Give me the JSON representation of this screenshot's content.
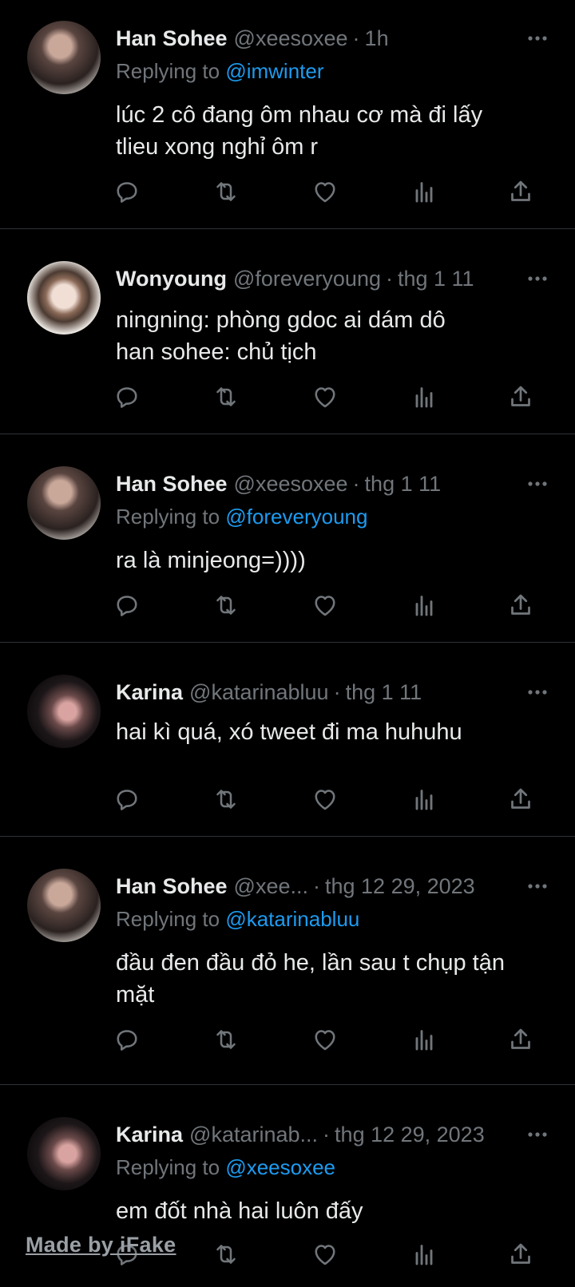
{
  "tweets": [
    {
      "name": "Han Sohee",
      "handle": "@xeesoxee",
      "sep": "·",
      "time": "1h",
      "replying_prefix": "Replying to",
      "replying_to": "@imwinter",
      "lines": [
        "lúc 2 cô đang ôm nhau cơ mà đi lấy",
        "tlieu xong nghỉ ôm r"
      ]
    },
    {
      "name": "Wonyoung",
      "handle": "@foreveryoung",
      "sep": "·",
      "time": "thg 1 11",
      "replying_prefix": "",
      "replying_to": "",
      "lines": [
        "ningning: phòng gdoc ai dám dô",
        "han sohee: chủ tịch"
      ]
    },
    {
      "name": "Han Sohee",
      "handle": "@xeesoxee",
      "sep": "·",
      "time": "thg 1 11",
      "replying_prefix": "Replying to",
      "replying_to": "@foreveryoung",
      "lines": [
        "ra là minjeong=))))"
      ]
    },
    {
      "name": "Karina",
      "handle": "@katarinabluu",
      "sep": "·",
      "time": "thg 1 11",
      "replying_prefix": "",
      "replying_to": "",
      "lines": [
        "hai kì quá, xó tweet đi ma huhuhu"
      ]
    },
    {
      "name": "Han Sohee",
      "handle": "@xee...",
      "sep": "·",
      "time": "thg 12 29, 2023",
      "replying_prefix": "Replying to",
      "replying_to": "@katarinabluu",
      "lines": [
        "đầu đen đầu đỏ he, lần sau t chụp tận",
        "mặt"
      ]
    },
    {
      "name": "Karina",
      "handle": "@katarinab...",
      "sep": "·",
      "time": "thg 12 29, 2023",
      "replying_prefix": "Replying to",
      "replying_to": "@xeesoxee",
      "lines": [
        "em đốt nhà hai luôn đấy"
      ]
    }
  ],
  "watermark": "Made by iFake",
  "colors": {
    "background": "#000000",
    "text": "#e7e9ea",
    "muted": "#71767b",
    "link": "#1d9bf0",
    "divider": "#2f3336"
  },
  "icons": [
    "reply-icon",
    "retweet-icon",
    "like-icon",
    "views-icon",
    "share-icon",
    "more-icon"
  ]
}
